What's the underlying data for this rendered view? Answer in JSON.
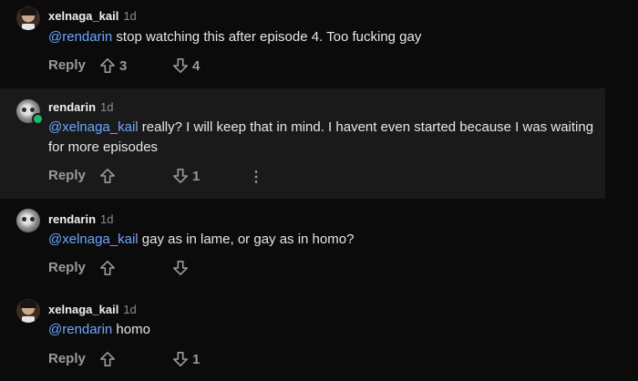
{
  "comments": [
    {
      "username": "xelnaga_kail",
      "time": "1d",
      "mention": "@rendarin",
      "text": " stop watching this after episode 4. Too fucking gay",
      "reply_label": "Reply",
      "upvotes": "3",
      "downvotes": "4",
      "avatar": "face-avatar"
    },
    {
      "username": "rendarin",
      "time": "1d",
      "mention": "@xelnaga_kail",
      "text": " really? I will keep that in mind. I havent even started because I was waiting for more episodes",
      "reply_label": "Reply",
      "upvotes": "",
      "downvotes": "1",
      "more_label": "⋮",
      "avatar": "alien-avatar",
      "online": true
    },
    {
      "username": "rendarin",
      "time": "1d",
      "mention": "@xelnaga_kail",
      "text": " gay as in lame, or gay as in homo?",
      "reply_label": "Reply",
      "upvotes": "",
      "downvotes": "",
      "avatar": "alien-avatar"
    },
    {
      "username": "xelnaga_kail",
      "time": "1d",
      "mention": "@rendarin",
      "text": " homo",
      "reply_label": "Reply",
      "upvotes": "",
      "downvotes": "1",
      "avatar": "face-avatar"
    }
  ],
  "colors": {
    "background": "#0b0b0b",
    "highlight": "#1a1a1a",
    "mention": "#6ea6ff",
    "online": "#1fb86a"
  }
}
